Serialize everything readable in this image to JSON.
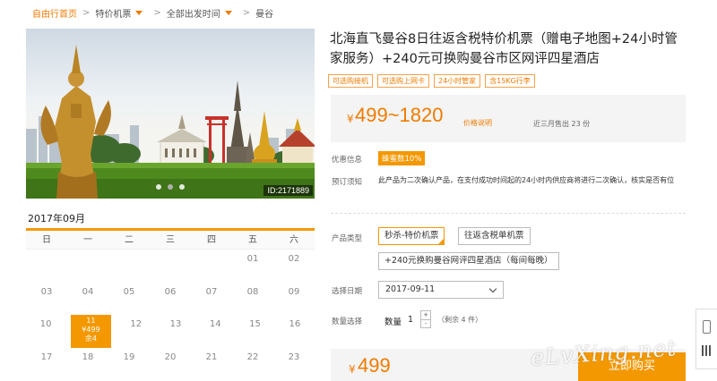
{
  "breadcrumb": [
    {
      "label": "自由行首页"
    },
    {
      "label": "特价机票"
    },
    {
      "label": "全部出发时间"
    },
    {
      "label": "曼谷"
    }
  ],
  "hero": {
    "image_id": "ID:2171889",
    "slide_count": 3,
    "active_slide": 2
  },
  "calendar": {
    "month": "2017年09月",
    "weekdays": [
      "日",
      "一",
      "二",
      "三",
      "四",
      "五",
      "六"
    ],
    "weeks": [
      [
        "",
        "",
        "",
        "",
        "",
        "01",
        "02"
      ],
      [
        "03",
        "04",
        "05",
        "06",
        "07",
        "08",
        "09"
      ],
      [
        "10",
        "11",
        "12",
        "13",
        "14",
        "15",
        "16"
      ],
      [
        "17",
        "18",
        "19",
        "20",
        "21",
        "22",
        "23"
      ]
    ],
    "selected": {
      "day": "11",
      "price": "¥499",
      "remain": "余4"
    }
  },
  "product": {
    "title": "北海直飞曼谷8日往返含税特价机票（赠电子地图+24小时管家服务）+240元可换购曼谷市区网评四星酒店",
    "tags": [
      "可选购接机",
      "可选购上网卡",
      "24小时管家",
      "含15KG行李"
    ]
  },
  "price": {
    "currency": "¥",
    "range": "499~1820",
    "note": "价格说明",
    "sold": "近三月售出 23 份"
  },
  "promo": {
    "label": "优惠信息",
    "badge": "蜂蜜数10%"
  },
  "notice": {
    "label": "预订须知",
    "text": "此产品为二次确认产品，在支付成功时间起的24小时内供应商将进行二次确认，核实是否有位"
  },
  "options": {
    "label": "产品类型",
    "items": [
      "秒杀-特价机票",
      "往返含税单机票",
      "+240元换购曼谷网评四星酒店（每间每晚）"
    ],
    "selected_index": 0
  },
  "date": {
    "label": "选择日期",
    "value": "2017-09-11"
  },
  "quantity": {
    "label": "数量选择",
    "name": "数量",
    "value": "1",
    "plus": "+",
    "minus": "-",
    "remain": "（剩余 4 件）"
  },
  "bottom": {
    "currency": "¥",
    "price": "499",
    "buy_label": "立即购买"
  },
  "watermark": "eLvXing.net",
  "colors": {
    "accent": "#f39800",
    "accent_text": "#f07b00"
  }
}
